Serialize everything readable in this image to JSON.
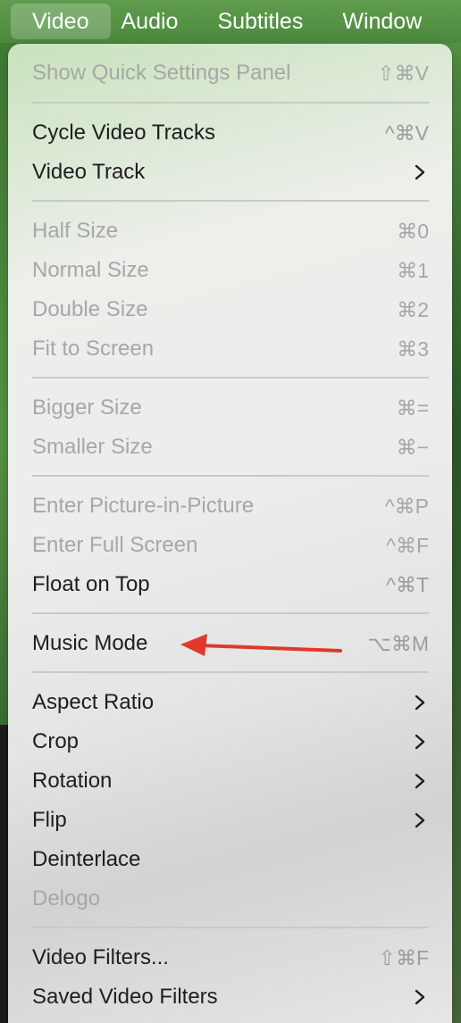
{
  "menubar": {
    "items": [
      "Video",
      "Audio",
      "Subtitles",
      "Window"
    ]
  },
  "menu": {
    "items": [
      {
        "label": "Show Quick Settings Panel",
        "shortcut": "⇧⌘V",
        "disabled": true
      },
      {
        "label": "Cycle Video Tracks",
        "shortcut": "^⌘V",
        "disabled": false
      },
      {
        "label": "Video Track",
        "submenu": true,
        "disabled": false
      },
      {
        "label": "Half Size",
        "shortcut": "⌘0",
        "disabled": true
      },
      {
        "label": "Normal Size",
        "shortcut": "⌘1",
        "disabled": true
      },
      {
        "label": "Double Size",
        "shortcut": "⌘2",
        "disabled": true
      },
      {
        "label": "Fit to Screen",
        "shortcut": "⌘3",
        "disabled": true
      },
      {
        "label": "Bigger Size",
        "shortcut": "⌘=",
        "disabled": true
      },
      {
        "label": "Smaller Size",
        "shortcut": "⌘−",
        "disabled": true
      },
      {
        "label": "Enter Picture-in-Picture",
        "shortcut": "^⌘P",
        "disabled": true
      },
      {
        "label": "Enter Full Screen",
        "shortcut": "^⌘F",
        "disabled": true
      },
      {
        "label": "Float on Top",
        "shortcut": "^⌘T",
        "disabled": false
      },
      {
        "label": "Music Mode",
        "shortcut": "⌥⌘M",
        "disabled": false
      },
      {
        "label": "Aspect Ratio",
        "submenu": true,
        "disabled": false
      },
      {
        "label": "Crop",
        "submenu": true,
        "disabled": false
      },
      {
        "label": "Rotation",
        "submenu": true,
        "disabled": false
      },
      {
        "label": "Flip",
        "submenu": true,
        "disabled": false
      },
      {
        "label": "Deinterlace",
        "disabled": false
      },
      {
        "label": "Delogo",
        "disabled": true
      },
      {
        "label": "Video Filters...",
        "shortcut": "⇧⌘F",
        "disabled": false
      },
      {
        "label": "Saved Video Filters",
        "submenu": true,
        "disabled": false
      }
    ]
  },
  "annotation": {
    "type": "arrow",
    "color": "#e0392b",
    "points_to": "Music Mode"
  },
  "colors": {
    "menubar": "#5a9748",
    "active_item_bg": "rgba(255,255,255,0.22)",
    "menu_bg": "#ececec",
    "text": "#1e1e1e",
    "disabled_text": "#a5a8a5"
  }
}
